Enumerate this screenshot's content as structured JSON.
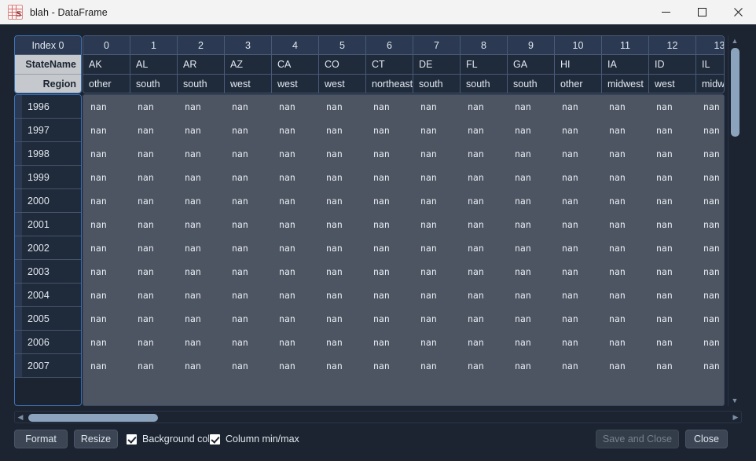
{
  "window": {
    "title": "blah - DataFrame",
    "icon": "dataframe-icon",
    "controls": {
      "minimize": "minimize-icon",
      "maximize": "maximize-icon",
      "close": "close-icon"
    }
  },
  "table": {
    "index_header": "Index 0",
    "level_labels": [
      "StateName",
      "Region"
    ],
    "column_numbers": [
      "0",
      "1",
      "2",
      "3",
      "4",
      "5",
      "6",
      "7",
      "8",
      "9",
      "10",
      "11",
      "12",
      "13"
    ],
    "state_names": [
      "AK",
      "AL",
      "AR",
      "AZ",
      "CA",
      "CO",
      "CT",
      "DE",
      "FL",
      "GA",
      "HI",
      "IA",
      "ID",
      "IL"
    ],
    "regions": [
      "other",
      "south",
      "south",
      "west",
      "west",
      "west",
      "northeast",
      "south",
      "south",
      "south",
      "other",
      "midwest",
      "west",
      "midwest"
    ],
    "row_labels": [
      "1996",
      "1997",
      "1998",
      "1999",
      "2000",
      "2001",
      "2002",
      "2003",
      "2004",
      "2005",
      "2006",
      "2007"
    ],
    "cell_value": "nan",
    "columns_visible": 14,
    "rows_visible": 12
  },
  "scrollbars": {
    "vertical": {
      "up_arrow": "caret-up-icon",
      "down_arrow": "caret-down-icon"
    },
    "horizontal": {
      "left_arrow": "caret-left-icon",
      "right_arrow": "caret-right-icon"
    }
  },
  "toolbar": {
    "format_label": "Format",
    "resize_label": "Resize",
    "background_color_label": "Background color",
    "background_color_checked": true,
    "column_minmax_label": "Column min/max",
    "column_minmax_checked": true,
    "save_and_close_label": "Save and Close",
    "save_and_close_enabled": false,
    "close_label": "Close"
  },
  "colors": {
    "titlebar_bg": "#f3f3f3",
    "window_bg": "#1b2430",
    "header_bg": "#2b3a52",
    "level_label_bg": "#c5c9ce",
    "data_cell_bg": "#4d5562",
    "focus_border": "#3d74b8",
    "scroll_thumb": "#8ba3bd"
  }
}
